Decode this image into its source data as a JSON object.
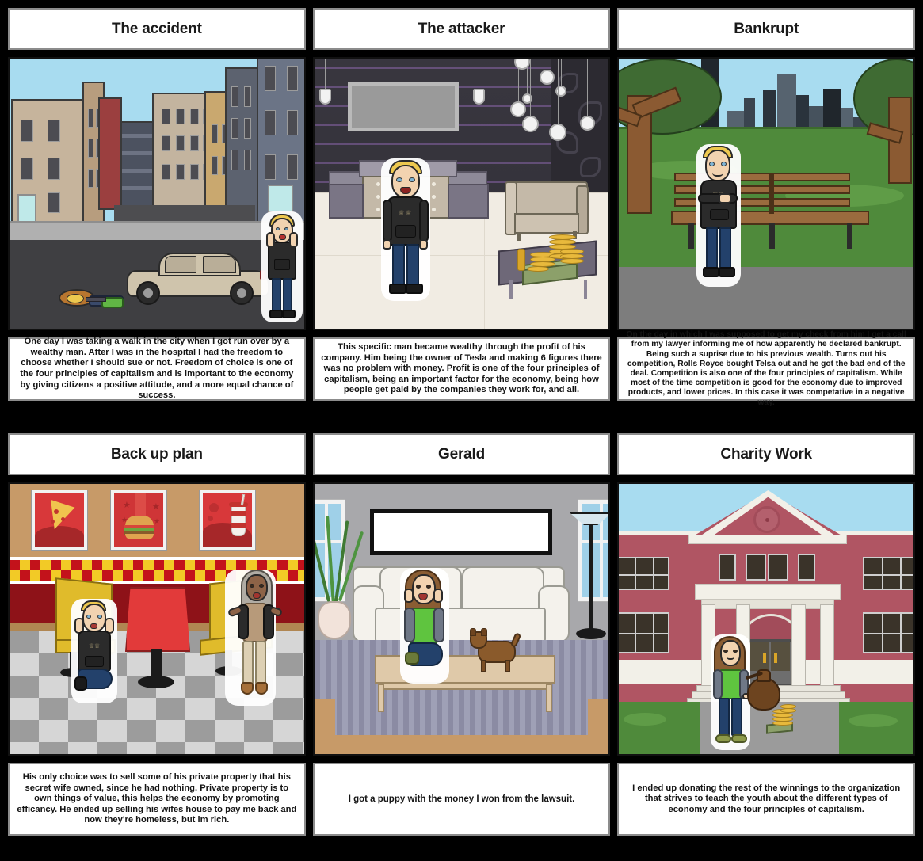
{
  "document": {
    "type": "storyboard",
    "columns": 3,
    "rows": 2,
    "background_color": "#000000",
    "panel_border_color": "#8c8c8c"
  },
  "cells": [
    {
      "id": "cell-1",
      "title": "The accident",
      "caption": "One day I was taking a walk in the city when I got run over by a wealthy man. After I was in the hospital I had the freedom to choose whether I should sue or not. Freedom of choice is one of the four principles of capitalism and is important to the economy by giving citizens a positive attitude, and a more equal chance of success.",
      "scene": "city-street-accident",
      "scene_elements": [
        "sky",
        "apartment-buildings",
        "road",
        "sidewalk",
        "beige-sedan-car",
        "person-knocked-down",
        "shocked-blonde-boy"
      ]
    },
    {
      "id": "cell-2",
      "title": "The attacker",
      "caption": "This specific man became wealthy through the profit of his company. Him being the owner of Tesla and making 6 figures there was no problem with money. Profit is one of the four principles of capitalism, being an important factor for the economy, being how people get paid by the companies they work for, and all.",
      "scene": "luxury-lounge",
      "scene_elements": [
        "dark-striped-wall",
        "flat-screen-tv",
        "pendant-light-bulbs",
        "bar-counter",
        "beige-sofa",
        "coffee-table",
        "gold-coin-stacks",
        "cash-stack",
        "blonde-man-in-hoodie"
      ]
    },
    {
      "id": "cell-3",
      "title": "Bankrupt",
      "caption": "On the day in which I was supposed to get my check from him I get a call from my lawyer informing me of how apparently he declared bankrupt. Being such a suprise due to his previous wealth. Turns out his competition, Rolls Royce bought Telsa out and he got the bad end of the deal. Competition is also one of the four principles of capitalism. While most of the time competition is good for the economy due to improved products, and lower prices. In this case it was competative in a negative way.",
      "scene": "city-park",
      "scene_elements": [
        "sky",
        "city-skyline",
        "trees",
        "grass",
        "wooden-park-bench",
        "path",
        "sad-blonde-man-arms-crossed"
      ]
    },
    {
      "id": "cell-4",
      "title": "Back up plan",
      "caption": "His only choice was to sell some of his private property that his secret wife owned, since he had nothing. Private property is to own things of value, this helps the economy by promoting efficancy. He ended up selling his wifes house to pay me back and now they're homeless, but im rich.",
      "scene": "fast-food-diner",
      "scene_elements": [
        "pizza-poster",
        "burger-poster",
        "soda-cup-poster",
        "checker-border",
        "red-wall",
        "checkered-floor",
        "yellow-booths",
        "red-table",
        "kneeling-blonde-boy",
        "angry-woman"
      ]
    },
    {
      "id": "cell-5",
      "title": "Gerald",
      "caption": "I got a puppy with the money I won from the lawsuit.",
      "scene": "living-room",
      "scene_elements": [
        "grey-wall",
        "windows",
        "blank-picture-frame",
        "potted-plant",
        "white-sofa",
        "floor-lamp",
        "striped-rug",
        "coffee-table",
        "excited-girl",
        "brown-puppy"
      ]
    },
    {
      "id": "cell-6",
      "title": "Charity Work",
      "caption": "I ended up donating the rest of the winnings to the organization that strives to teach the youth about the different types of economy and the four principles of capitalism.",
      "scene": "brick-institution-building",
      "scene_elements": [
        "sky",
        "red-brick-building",
        "pediment",
        "columns",
        "arched-doorway",
        "stairs",
        "grass",
        "walkway",
        "girl-with-money-bag",
        "gold-coins",
        "cash-stack"
      ]
    }
  ],
  "colors": {
    "sky": "#a8dcf0",
    "grass": "#4f8a3b",
    "road": "#3f3f42",
    "brick": "#b05563",
    "diner_red": "#8e1218",
    "diner_yellow": "#f2ca26",
    "gold": "#e8b93c"
  }
}
